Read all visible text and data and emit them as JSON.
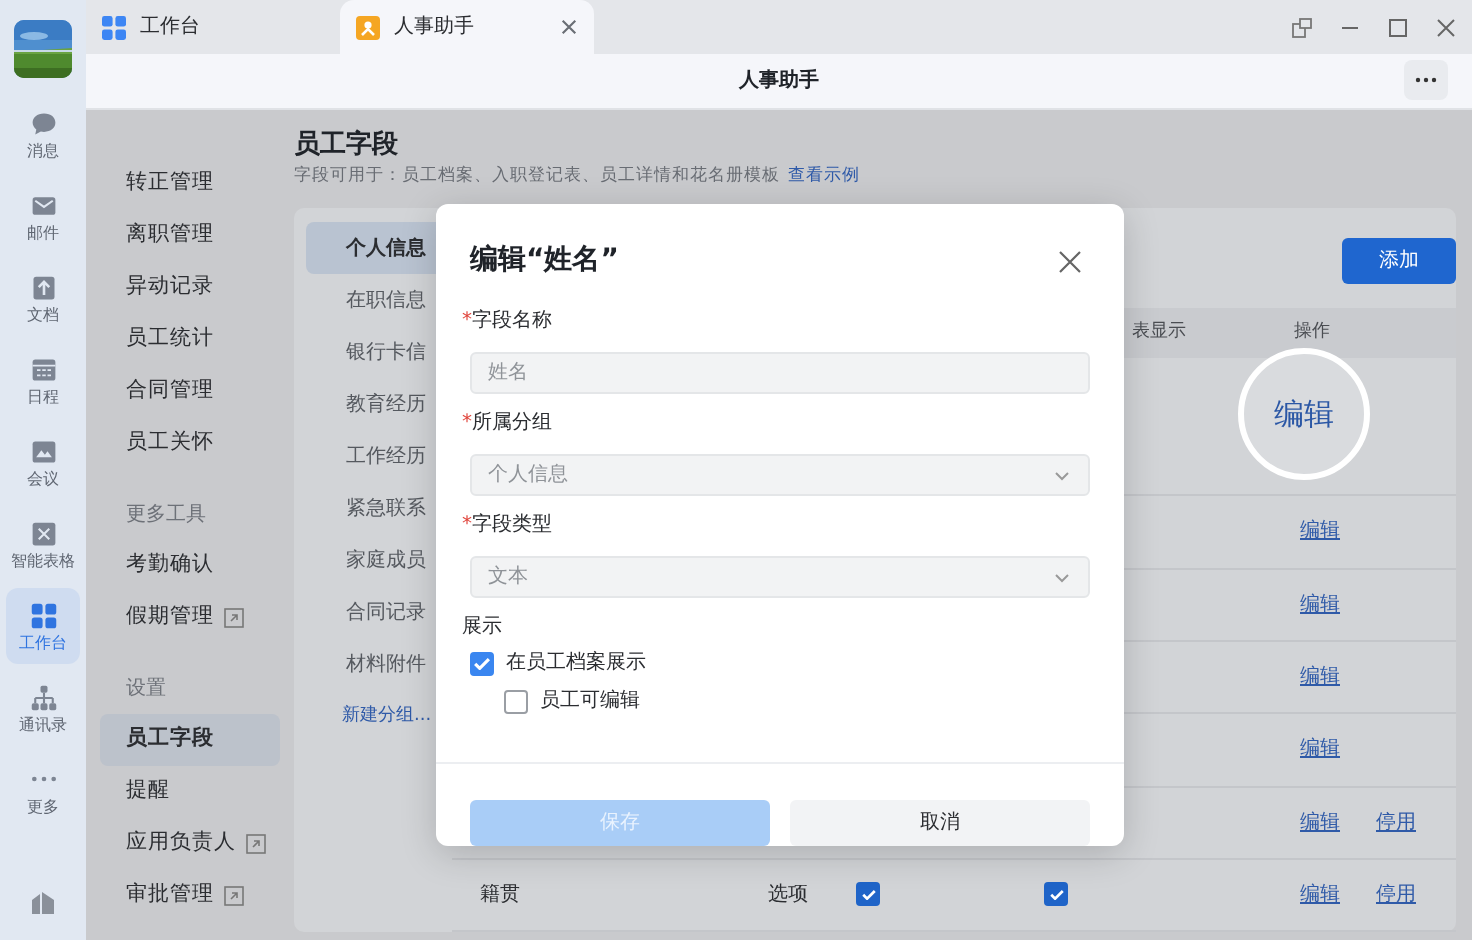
{
  "window": {
    "tabs": [
      {
        "label": "工作台",
        "selected": false
      },
      {
        "label": "人事助手",
        "selected": true
      }
    ],
    "title": "人事助手"
  },
  "rail": {
    "items": [
      {
        "label": "消息",
        "selected": false
      },
      {
        "label": "邮件",
        "selected": false
      },
      {
        "label": "文档",
        "selected": false
      },
      {
        "label": "日程",
        "selected": false
      },
      {
        "label": "会议",
        "selected": false
      },
      {
        "label": "智能表格",
        "selected": false
      },
      {
        "label": "工作台",
        "selected": true
      },
      {
        "label": "通讯录",
        "selected": false
      },
      {
        "label": "更多",
        "selected": false
      }
    ]
  },
  "menu": {
    "groups": [
      {
        "items": [
          {
            "label": "转正管理",
            "selected": false,
            "external": false
          },
          {
            "label": "离职管理",
            "selected": false,
            "external": false
          },
          {
            "label": "异动记录",
            "selected": false,
            "external": false
          },
          {
            "label": "员工统计",
            "selected": false,
            "external": false
          },
          {
            "label": "合同管理",
            "selected": false,
            "external": false
          },
          {
            "label": "员工关怀",
            "selected": false,
            "external": false
          }
        ]
      },
      {
        "heading": "更多工具",
        "items": [
          {
            "label": "考勤确认",
            "selected": false,
            "external": false
          },
          {
            "label": "假期管理",
            "selected": false,
            "external": true
          }
        ]
      },
      {
        "heading": "设置",
        "items": [
          {
            "label": "员工字段",
            "selected": true,
            "external": false
          },
          {
            "label": "提醒",
            "selected": false,
            "external": false
          },
          {
            "label": "应用负责人",
            "selected": false,
            "external": true
          },
          {
            "label": "审批管理",
            "selected": false,
            "external": true
          }
        ]
      }
    ]
  },
  "page": {
    "title": "员工字段",
    "description": "字段可用于：员工档案、入职登记表、员工详情和花名册模板",
    "link": "查看示例"
  },
  "groups": {
    "items": [
      {
        "label": "个人信息",
        "selected": true
      },
      {
        "label": "在职信息",
        "selected": false
      },
      {
        "label": "银行卡信",
        "selected": false
      },
      {
        "label": "教育经历",
        "selected": false
      },
      {
        "label": "工作经历",
        "selected": false
      },
      {
        "label": "紧急联系",
        "selected": false
      },
      {
        "label": "家庭成员",
        "selected": false
      },
      {
        "label": "合同记录",
        "selected": false
      },
      {
        "label": "材料附件",
        "selected": false
      }
    ],
    "new_group": "新建分组..."
  },
  "add_button": "添加",
  "table": {
    "columns": [
      "表显示",
      "操作"
    ],
    "highlight": "编辑",
    "rows": [
      {
        "actions": [
          "编辑"
        ]
      },
      {
        "actions": [
          "编辑"
        ]
      },
      {
        "actions": [
          "编辑"
        ]
      },
      {
        "actions": [
          "编辑"
        ]
      },
      {
        "actions": [
          "编辑",
          "停用"
        ]
      },
      {
        "column_1": "籍贯",
        "column_2": "选项",
        "check_1": true,
        "check_2": true,
        "actions": [
          "编辑",
          "停用"
        ]
      }
    ]
  },
  "modal": {
    "title": "编辑“姓名”",
    "fields": [
      {
        "label": "字段名称",
        "required_mark": "*",
        "kind": "text",
        "value": "姓名",
        "disabled": true
      },
      {
        "label": "所属分组",
        "required_mark": "*",
        "kind": "select",
        "value": "个人信息",
        "disabled": true
      },
      {
        "label": "字段类型",
        "required_mark": "*",
        "kind": "select",
        "value": "文本",
        "disabled": true
      }
    ],
    "display": {
      "label": "展示",
      "options": [
        {
          "label": "在员工档案展示",
          "checked": true,
          "children": [
            {
              "label": "员工可编辑",
              "checked": false
            }
          ]
        }
      ]
    },
    "buttons": [
      {
        "label": "保存",
        "kind": "primary",
        "disabled": true
      },
      {
        "label": "取消",
        "kind": "secondary",
        "disabled": false
      }
    ]
  }
}
